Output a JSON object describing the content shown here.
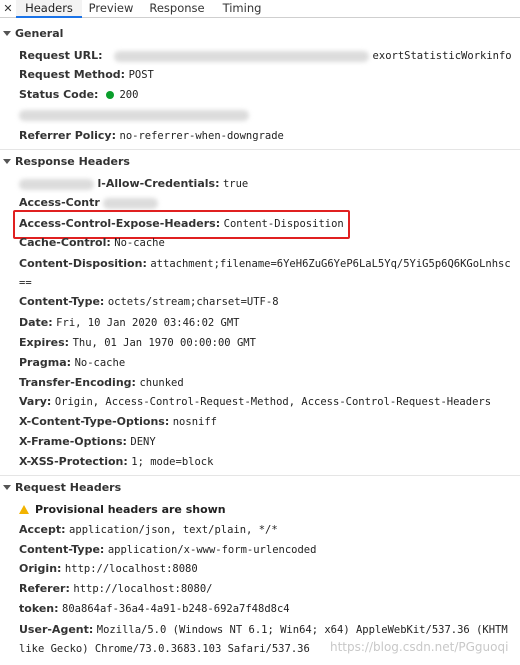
{
  "tabs": {
    "close_icon": "✕",
    "items": [
      "Headers",
      "Preview",
      "Response",
      "Timing"
    ],
    "active": "Headers",
    "accent": "#1a73e8"
  },
  "general": {
    "title": "General",
    "request_url": {
      "key": "Request URL:",
      "value_tail": "exortStatisticWorkinfo"
    },
    "request_method": {
      "key": "Request Method:",
      "value": "POST"
    },
    "status_code": {
      "key": "Status Code:",
      "value": "200",
      "status_color": "#0a9e2c"
    },
    "referrer_policy": {
      "key": "Referrer Policy:",
      "value": "no-referrer-when-downgrade"
    }
  },
  "response_headers": {
    "title": "Response Headers",
    "allow_credentials": {
      "key_tail": "l-Allow-Credentials:",
      "value": "true"
    },
    "access_control_partial": {
      "key": "Access-Contr"
    },
    "expose_headers": {
      "key": "Access-Control-Expose-Headers:",
      "value": "Content-Disposition"
    },
    "cache_control": {
      "key": "Cache-Control:",
      "value": "No-cache"
    },
    "content_disposition": {
      "key": "Content-Disposition:",
      "value": "attachment;filename=6YeH6ZuG6YeP6LaL5Yq/5YiG5p6Q6KGoLnhsc",
      "value_cont": "=="
    },
    "content_type": {
      "key": "Content-Type:",
      "value": "octets/stream;charset=UTF-8"
    },
    "date": {
      "key": "Date:",
      "value": "Fri, 10 Jan 2020 03:46:02 GMT"
    },
    "expires": {
      "key": "Expires:",
      "value": "Thu, 01 Jan 1970 00:00:00 GMT"
    },
    "pragma": {
      "key": "Pragma:",
      "value": "No-cache"
    },
    "transfer_encoding": {
      "key": "Transfer-Encoding:",
      "value": "chunked"
    },
    "vary": {
      "key": "Vary:",
      "value": "Origin, Access-Control-Request-Method, Access-Control-Request-Headers"
    },
    "x_content_type_options": {
      "key": "X-Content-Type-Options:",
      "value": "nosniff"
    },
    "x_frame_options": {
      "key": "X-Frame-Options:",
      "value": "DENY"
    },
    "x_xss_protection": {
      "key": "X-XSS-Protection:",
      "value": "1; mode=block"
    }
  },
  "request_headers": {
    "title": "Request Headers",
    "provisional": "Provisional headers are shown",
    "accept": {
      "key": "Accept:",
      "value": "application/json, text/plain, */*"
    },
    "content_type": {
      "key": "Content-Type:",
      "value": "application/x-www-form-urlencoded"
    },
    "origin": {
      "key": "Origin:",
      "value": "http://localhost:8080"
    },
    "referer": {
      "key": "Referer:",
      "value": "http://localhost:8080/"
    },
    "token": {
      "key": "token:",
      "value": "80a864af-36a4-4a91-b248-692a7f48d8c4"
    },
    "user_agent": {
      "key": "User-Agent:",
      "value": "Mozilla/5.0 (Windows NT 6.1; Win64; x64) AppleWebKit/537.36 (KHTM",
      "value_cont": "like Gecko) Chrome/73.0.3683.103 Safari/537.36"
    }
  },
  "watermark": "https://blog.csdn.net/PGguoqi",
  "highlight_color": "#e02020"
}
